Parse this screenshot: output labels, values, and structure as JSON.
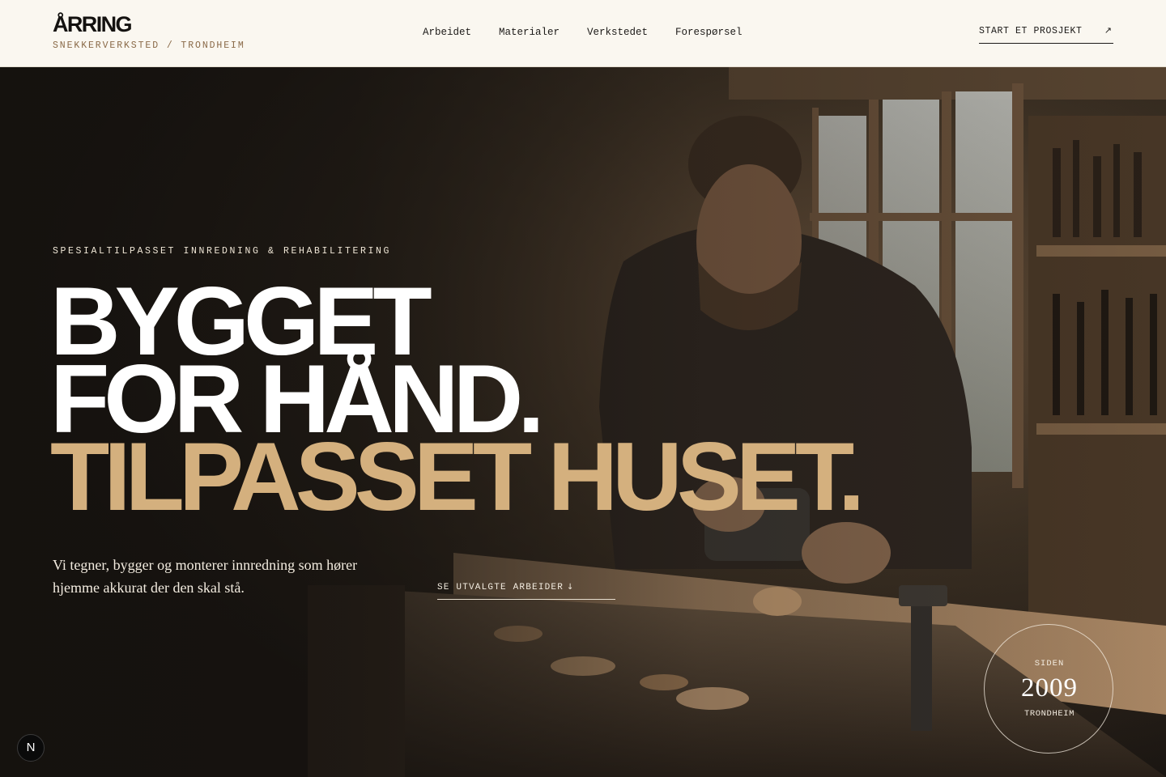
{
  "brand": {
    "name": "ÅRRING",
    "subtitle": "SNEKKERVERKSTED / TRONDHEIM"
  },
  "nav": {
    "items": [
      "Arbeidet",
      "Materialer",
      "Verkstedet",
      "Forespørsel"
    ]
  },
  "header": {
    "cta_label": "START ET PROSJEKT",
    "cta_icon": "arrow-up-right-icon"
  },
  "hero": {
    "eyebrow": "SPESIALTILPASSET INNREDNING & REHABILITERING",
    "headline_line1": "BYGGET",
    "headline_line2": "FOR HÅND.",
    "headline_line3": "TILPASSET HUSET.",
    "lead": "Vi tegner, bygger og monterer innredning som hører hjemme akkurat der den skal stå.",
    "works_link_label": "SE UTVALGTE ARBEIDER",
    "works_link_icon": "arrow-down-icon"
  },
  "badge": {
    "top": "SIDEN",
    "year": "2009",
    "bottom": "TRONDHEIM"
  },
  "dev_badge": {
    "letter": "N"
  },
  "colors": {
    "accent": "#d4b07e",
    "header_bg": "#faf7f0",
    "ink": "#1c1a18",
    "brand_sub": "#8a6a48"
  }
}
